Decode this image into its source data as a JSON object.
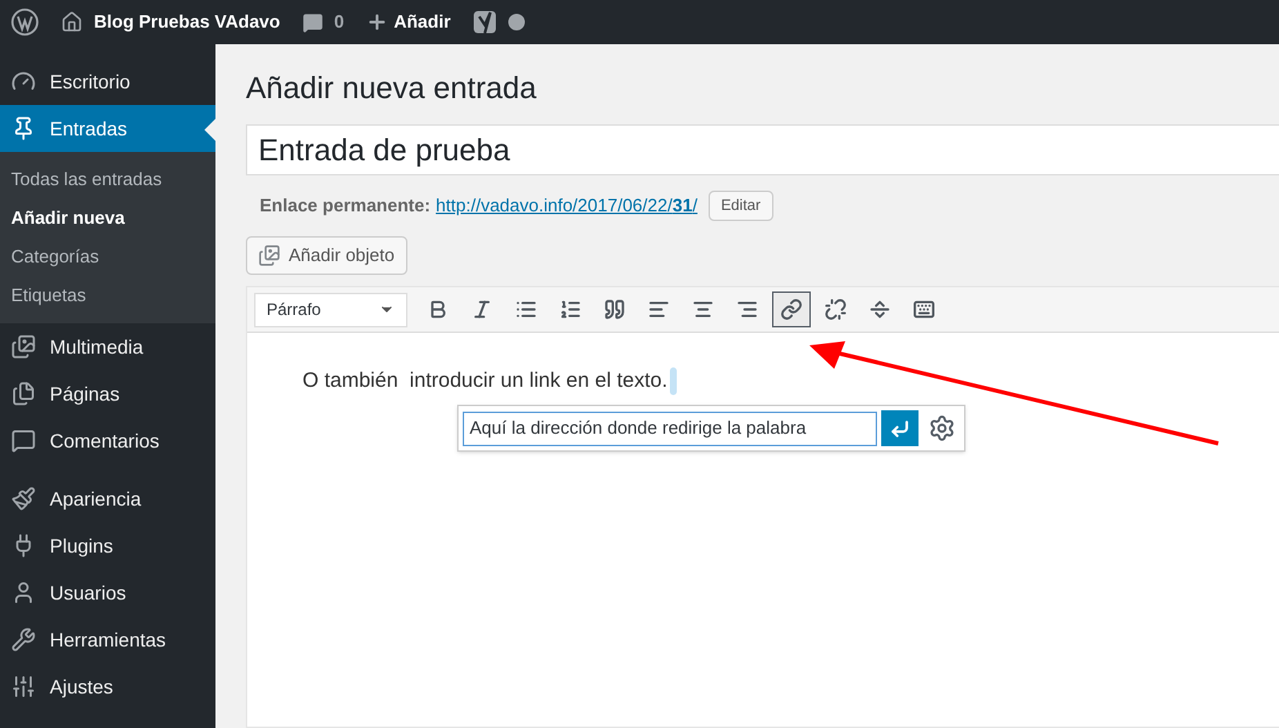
{
  "admin_bar": {
    "site_name": "Blog Pruebas VAdavo",
    "comments_count": "0",
    "new_label": "Añadir"
  },
  "sidebar": {
    "items": [
      {
        "label": "Escritorio",
        "selected": false
      },
      {
        "label": "Entradas",
        "selected": true,
        "children": [
          {
            "label": "Todas las entradas",
            "selected": false
          },
          {
            "label": "Añadir nueva",
            "selected": true
          },
          {
            "label": "Categorías",
            "selected": false
          },
          {
            "label": "Etiquetas",
            "selected": false
          }
        ]
      },
      {
        "label": "Multimedia",
        "selected": false
      },
      {
        "label": "Páginas",
        "selected": false
      },
      {
        "label": "Comentarios",
        "selected": false
      },
      {
        "label": "Apariencia",
        "selected": false
      },
      {
        "label": "Plugins",
        "selected": false
      },
      {
        "label": "Usuarios",
        "selected": false
      },
      {
        "label": "Herramientas",
        "selected": false
      },
      {
        "label": "Ajustes",
        "selected": false
      }
    ]
  },
  "page": {
    "heading": "Añadir nueva entrada",
    "title_value": "Entrada de prueba",
    "permalink_label": "Enlace permanente:",
    "permalink_url": "http://vadavo.info/2017/06/22/**31**/",
    "edit_button": "Editar",
    "add_media_button": "Añadir objeto"
  },
  "editor": {
    "format_select": "Párrafo",
    "toolbar": [
      {
        "active": false
      },
      {
        "active": false
      },
      {
        "active": false
      },
      {
        "active": false
      },
      {
        "active": false
      },
      {
        "active": false
      },
      {
        "active": false
      },
      {
        "active": false
      },
      {
        "active": true
      },
      {
        "active": false
      },
      {
        "active": false
      },
      {
        "active": false
      }
    ],
    "content": "O también  introducir un link en el texto.",
    "link_popup": {
      "value": "Aquí la dirección donde redirige la palabra"
    }
  }
}
